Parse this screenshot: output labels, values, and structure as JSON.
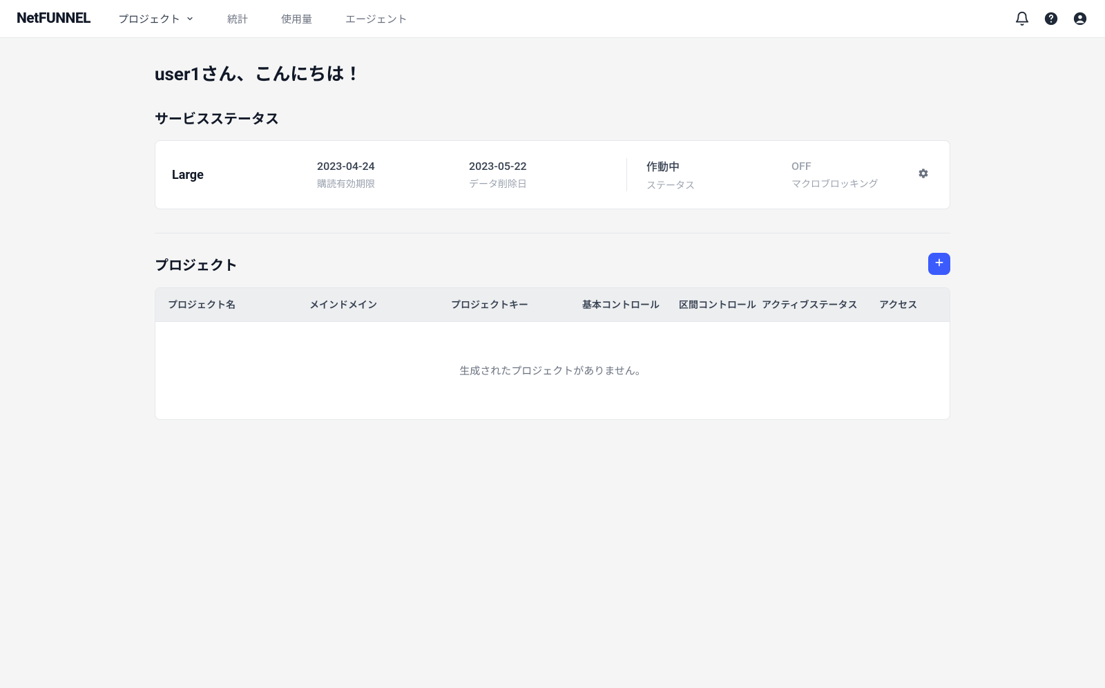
{
  "brand": "NetFUNNEL",
  "nav": {
    "project": "プロジェクト",
    "stats": "統計",
    "usage": "使用量",
    "agent": "エージェント"
  },
  "greeting": "user1さん、こんにちは！",
  "serviceStatus": {
    "title": "サービスステータス",
    "plan": "Large",
    "subscription": {
      "value": "2023-04-24",
      "label": "購読有効期限"
    },
    "deletion": {
      "value": "2023-05-22",
      "label": "データ削除日"
    },
    "running": {
      "value": "作動中",
      "label": "ステータス"
    },
    "macro": {
      "value": "OFF",
      "label": "マクロブロッキング"
    }
  },
  "projects": {
    "title": "プロジェクト",
    "columns": {
      "name": "プロジェクト名",
      "domain": "メインドメイン",
      "key": "プロジェクトキー",
      "basic": "基本コントロール",
      "section": "区間コントロール",
      "active": "アクティブステータス",
      "access": "アクセス"
    },
    "empty": "生成されたプロジェクトがありません。"
  }
}
